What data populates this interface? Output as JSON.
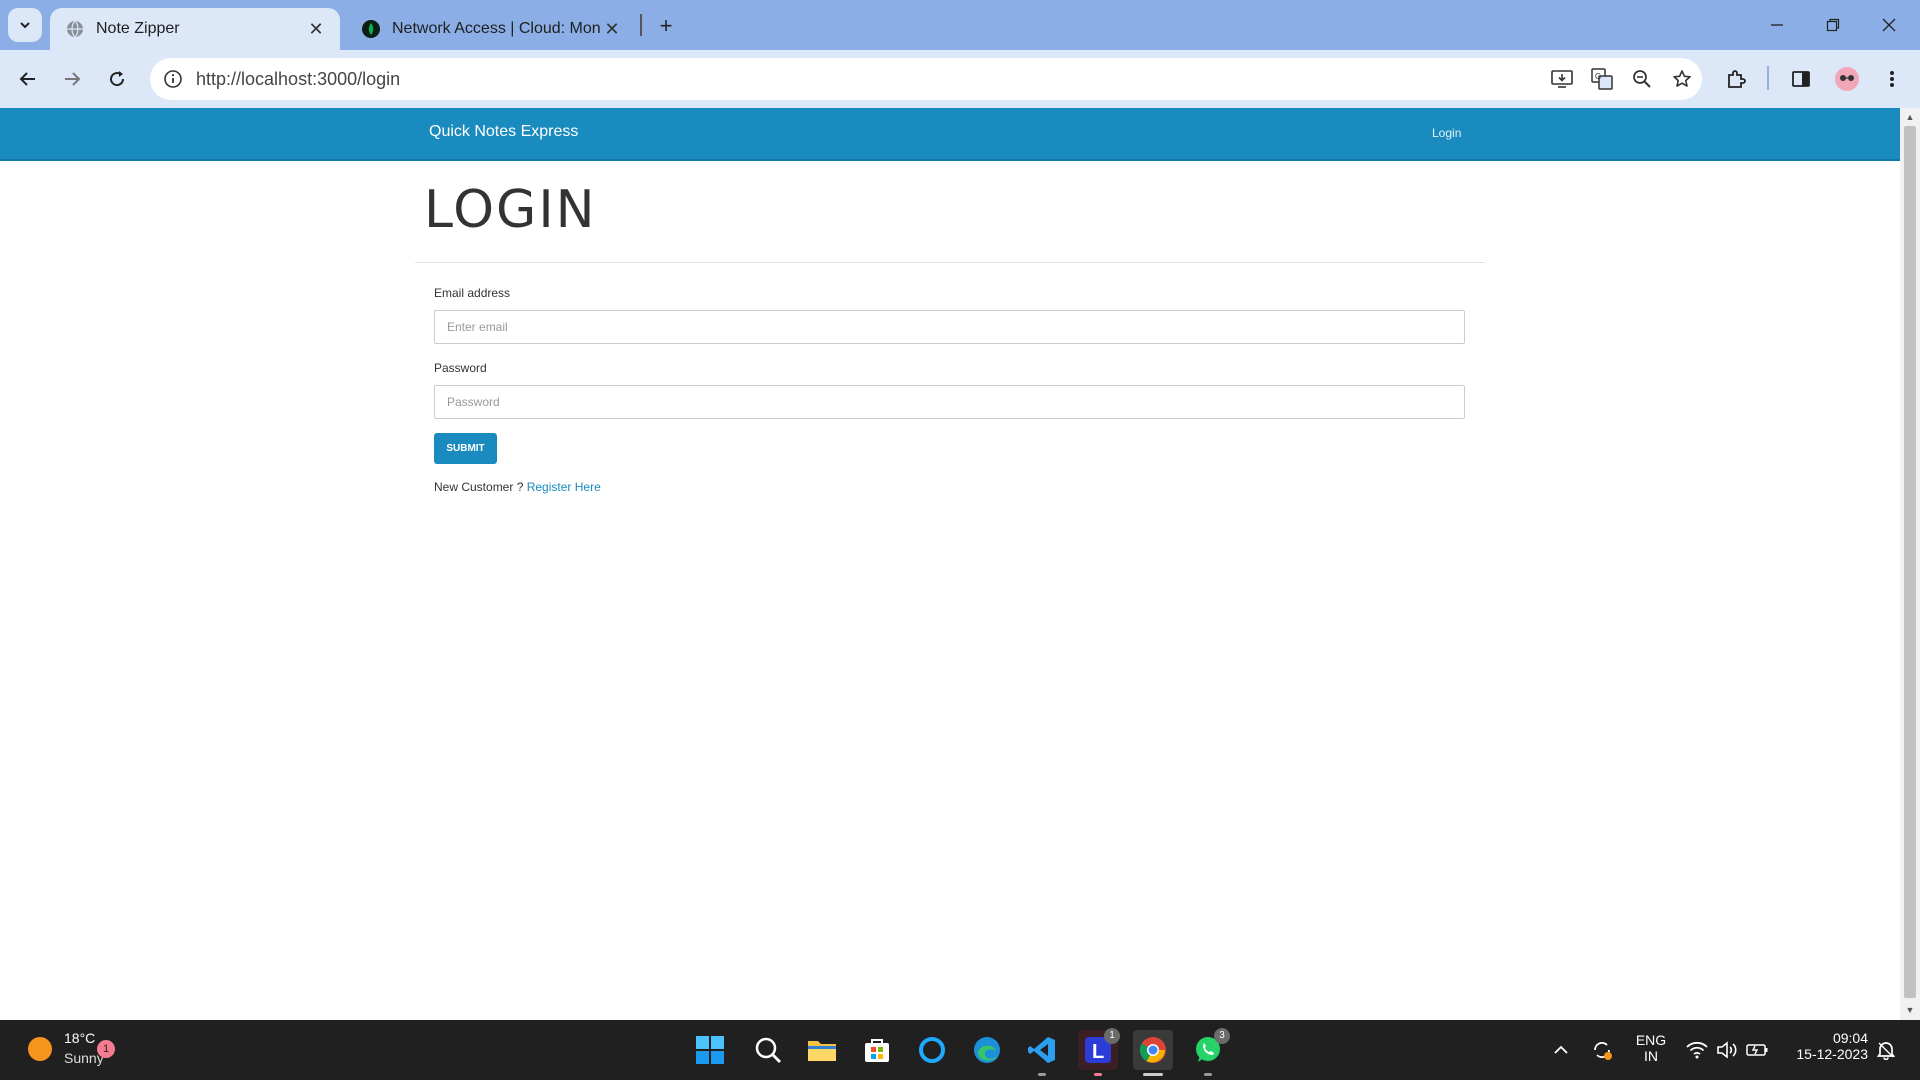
{
  "browser": {
    "tabs": [
      {
        "title": "Note Zipper",
        "active": true
      },
      {
        "title": "Network Access | Cloud: Mongo",
        "active": false
      }
    ],
    "url": "http://localhost:3000/login"
  },
  "site": {
    "brand": "Quick Notes Express",
    "nav_login": "Login",
    "heading": "LOGIN",
    "form": {
      "email_label": "Email address",
      "email_placeholder": "Enter email",
      "password_label": "Password",
      "password_placeholder": "Password",
      "submit_label": "SUBMIT",
      "new_customer_text": "New Customer ?",
      "register_link": "Register Here"
    }
  },
  "taskbar": {
    "weather_temp": "18°C",
    "weather_condition": "Sunny",
    "weather_badge": "1",
    "badges": {
      "app_l": "1",
      "whatsapp": "3"
    },
    "lang_line1": "ENG",
    "lang_line2": "IN",
    "time": "09:04",
    "date": "15-12-2023"
  },
  "colors": {
    "brand": "#1a8bbf",
    "tabbar": "#8aaee5",
    "toolbar": "#dce7f8",
    "taskbar": "#202020"
  }
}
